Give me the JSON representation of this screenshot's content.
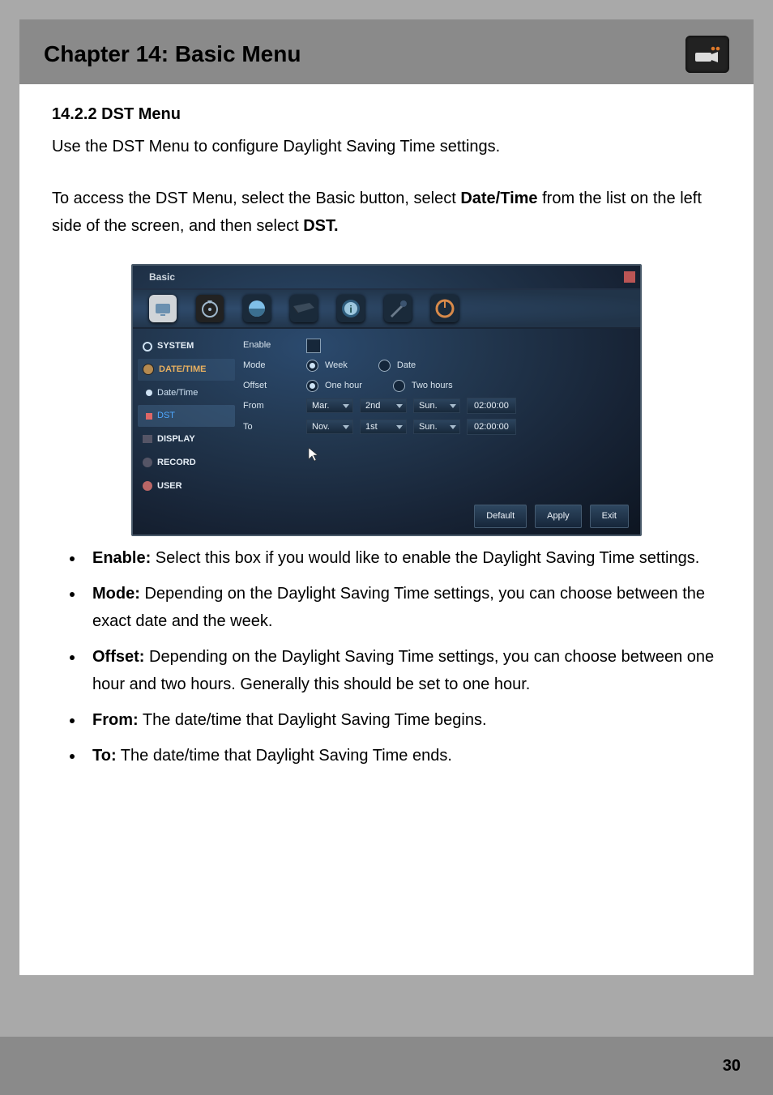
{
  "header": {
    "title": "Chapter 14: Basic Menu"
  },
  "section": {
    "heading": "14.2.2 DST Menu",
    "p1": "Use the DST Menu to configure Daylight Saving Time settings.",
    "p2_prefix": "To access the DST Menu, select the Basic button, select ",
    "p2_bold1": "Date/Time",
    "p2_mid": " from the list on the left side of the screen, and then select ",
    "p2_bold2": "DST."
  },
  "screenshot": {
    "window_title": "Basic",
    "sidebar": {
      "system": "SYSTEM",
      "date_time_head": "DATE/TIME",
      "date_time_sub": "Date/Time",
      "dst_sub": "DST",
      "display": "DISPLAY",
      "record": "RECORD",
      "user": "USER"
    },
    "form": {
      "enable_label": "Enable",
      "mode_label": "Mode",
      "mode_week": "Week",
      "mode_date": "Date",
      "offset_label": "Offset",
      "offset_one": "One hour",
      "offset_two": "Two hours",
      "from_label": "From",
      "to_label": "To",
      "from": {
        "month": "Mar.",
        "ord": "2nd",
        "day": "Sun.",
        "time": "02:00:00"
      },
      "to": {
        "month": "Nov.",
        "ord": "1st",
        "day": "Sun.",
        "time": "02:00:00"
      }
    },
    "buttons": {
      "default": "Default",
      "apply": "Apply",
      "exit": "Exit"
    }
  },
  "bullets": {
    "enable_b": "Enable:",
    "enable_t": " Select this box if you would like to enable the Daylight Saving Time settings.",
    "mode_b": "Mode:",
    "mode_t": " Depending on the Daylight Saving Time settings, you can choose between the exact date and the week.",
    "offset_b": "Offset:",
    "offset_t": " Depending on the Daylight Saving Time settings, you can choose between one hour and two hours. Generally this should be set to one hour.",
    "from_b": "From:",
    "from_t": " The date/time that Daylight Saving Time begins.",
    "to_b": "To:",
    "to_t": " The date/time that Daylight Saving Time ends."
  },
  "page_number": "30"
}
